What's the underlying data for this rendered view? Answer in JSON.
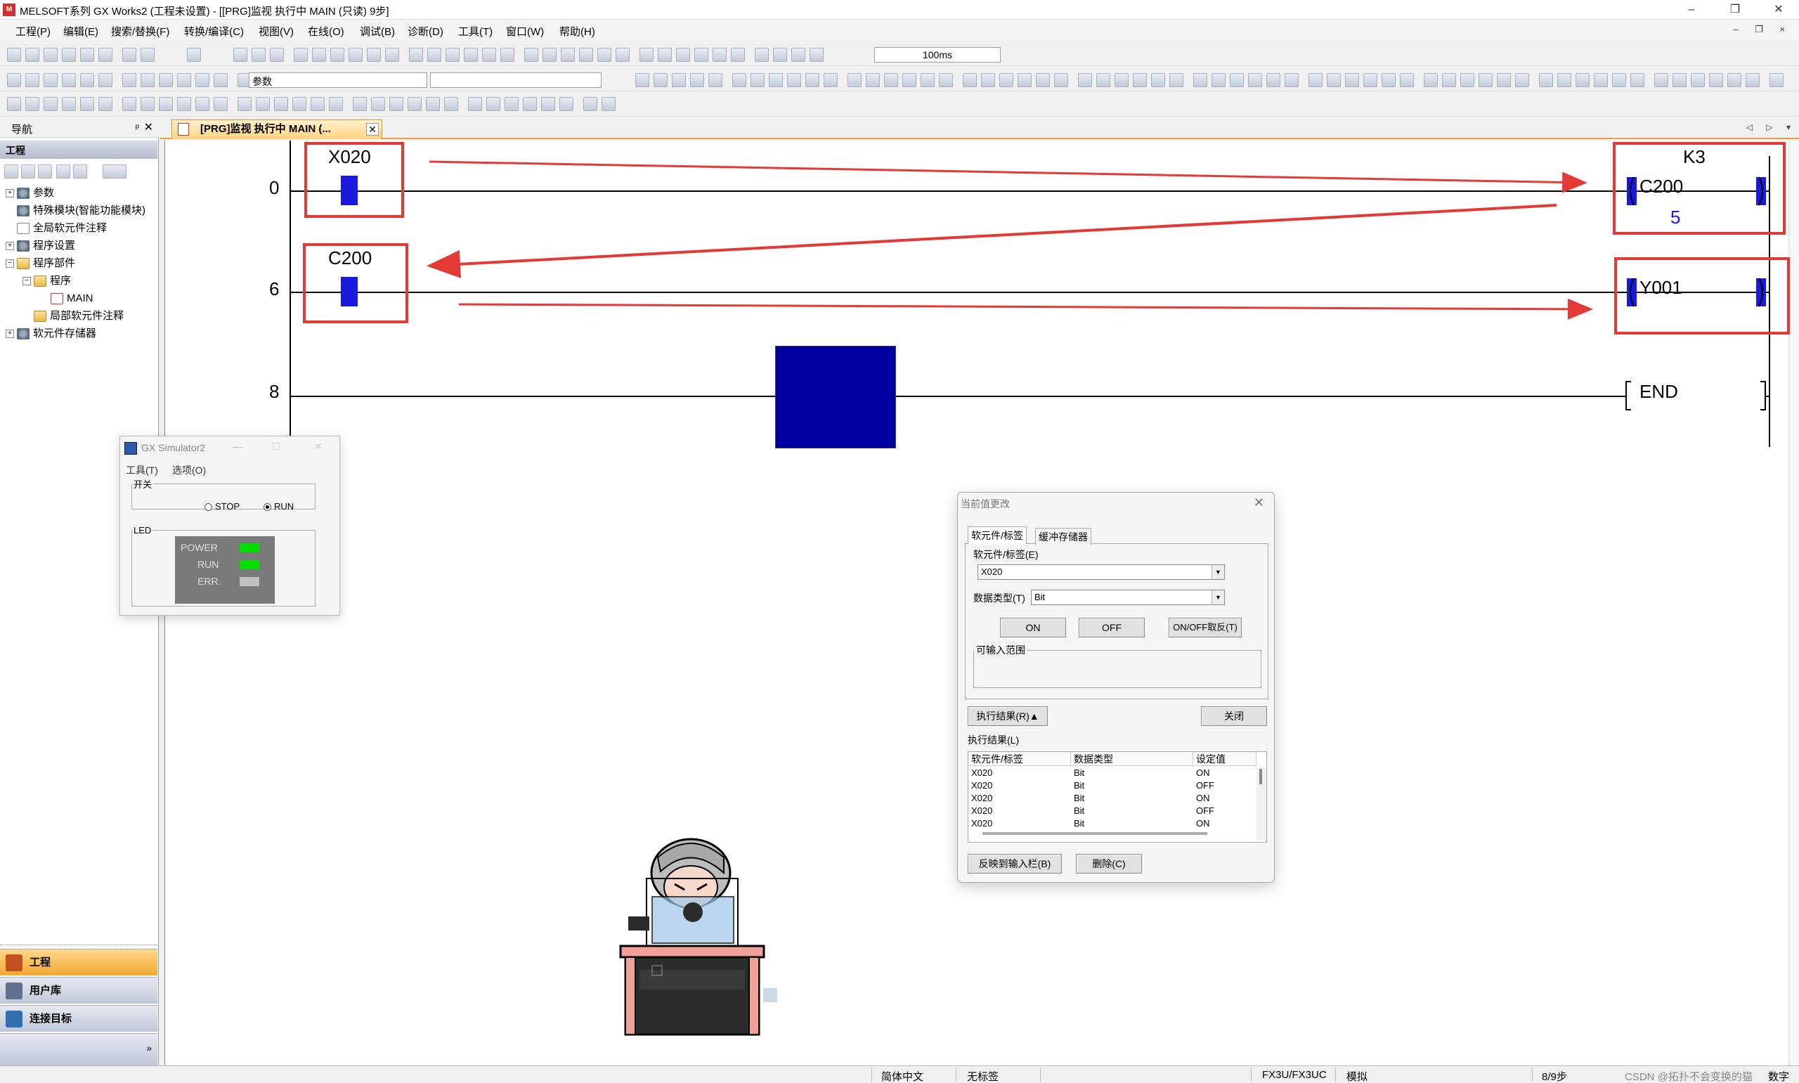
{
  "window": {
    "title": "MELSOFT系列 GX Works2 (工程未设置) - [[PRG]监视 执行中 MAIN (只读) 9步]",
    "app_icon": "melsoft-logo",
    "controls": [
      "–",
      "❐",
      "✕"
    ],
    "mdi_controls": "– ❐ ×"
  },
  "menubar": {
    "items": [
      "工程(P)",
      "编辑(E)",
      "搜索/替换(F)",
      "转换/编译(C)",
      "视图(V)",
      "在线(O)",
      "调试(B)",
      "诊断(D)",
      "工具(T)",
      "窗口(W)",
      "帮助(H)"
    ]
  },
  "toolbar": {
    "interval_value": "100ms",
    "param_combo": "参数"
  },
  "nav": {
    "header": "导航",
    "pin": "ᵖ",
    "close": "✕",
    "section": "工程",
    "tree": [
      {
        "label": "参数",
        "indent": 0,
        "exp": "+",
        "icon": "gear"
      },
      {
        "label": "特殊模块(智能功能模块)",
        "indent": 0,
        "exp": "",
        "icon": "gear"
      },
      {
        "label": "全局软元件注释",
        "indent": 0,
        "exp": "",
        "icon": "doc"
      },
      {
        "label": "程序设置",
        "indent": 0,
        "exp": "+",
        "icon": "gear"
      },
      {
        "label": "程序部件",
        "indent": 0,
        "exp": "−",
        "icon": "folder"
      },
      {
        "label": "程序",
        "indent": 1,
        "exp": "−",
        "icon": "folder"
      },
      {
        "label": "MAIN",
        "indent": 2,
        "exp": "",
        "icon": "prog"
      },
      {
        "label": "局部软元件注释",
        "indent": 1,
        "exp": "",
        "icon": "folder"
      },
      {
        "label": "软元件存储器",
        "indent": 0,
        "exp": "+",
        "icon": "gear"
      }
    ],
    "bottom_tabs": [
      "工程",
      "用户库",
      "连接目标"
    ]
  },
  "editor": {
    "tab_label": "[PRG]监视 执行中 MAIN (...",
    "tab_close": "✕",
    "scroll_arrows": "◁ ▷ ▾",
    "rungs": [
      {
        "step": "0",
        "contact": "X020",
        "coil": "C200",
        "coil_const": "K3",
        "current_value": "5"
      },
      {
        "step": "6",
        "contact": "C200",
        "coil": "Y001"
      },
      {
        "step": "8",
        "instruction": "END"
      }
    ]
  },
  "simulator": {
    "title": "GX Simulator2",
    "menu": [
      "工具(T)",
      "选项(O)"
    ],
    "switch_group": "开关",
    "stop_label": "STOP",
    "run_label": "RUN",
    "mode": "RUN",
    "led_group": "LED",
    "leds": [
      {
        "name": "POWER",
        "state": "on",
        "color": "#00e000"
      },
      {
        "name": "RUN",
        "state": "on",
        "color": "#00e000"
      },
      {
        "name": "ERR.",
        "state": "off",
        "color": "#c0c0c0"
      }
    ]
  },
  "dialog": {
    "title": "当前值更改",
    "close": "✕",
    "tabs": [
      "软元件/标签",
      "缓冲存储器"
    ],
    "device_label": "软元件/标签(E)",
    "device_value": "X020",
    "datatype_label": "数据类型(T)",
    "datatype_value": "Bit",
    "btn_on": "ON",
    "btn_off": "OFF",
    "btn_toggle": "ON/OFF取反(T)",
    "range_group": "可输入范围",
    "btn_result": "执行结果(R)▲",
    "btn_close": "关闭",
    "result_label": "执行结果(L)",
    "table_headers": [
      "软元件/标签",
      "数据类型",
      "设定值"
    ],
    "table_rows": [
      [
        "X020",
        "Bit",
        "ON"
      ],
      [
        "X020",
        "Bit",
        "OFF"
      ],
      [
        "X020",
        "Bit",
        "ON"
      ],
      [
        "X020",
        "Bit",
        "OFF"
      ],
      [
        "X020",
        "Bit",
        "ON"
      ]
    ],
    "btn_reflect": "反映到输入栏(B)",
    "btn_delete": "删除(C)"
  },
  "statusbar": {
    "language": "简体中文",
    "label": "无标签",
    "plc": "FX3U/FX3UC",
    "mode": "模拟",
    "steps": "8/9步",
    "watermark": "CSDN @拓扑不会变换的猫",
    "numlock": "数字"
  },
  "colors": {
    "contact_on": "#1a1adf",
    "highlight_block": "#0000a0",
    "annotation_red": "#e53935",
    "current_value": "#1a1aff"
  }
}
